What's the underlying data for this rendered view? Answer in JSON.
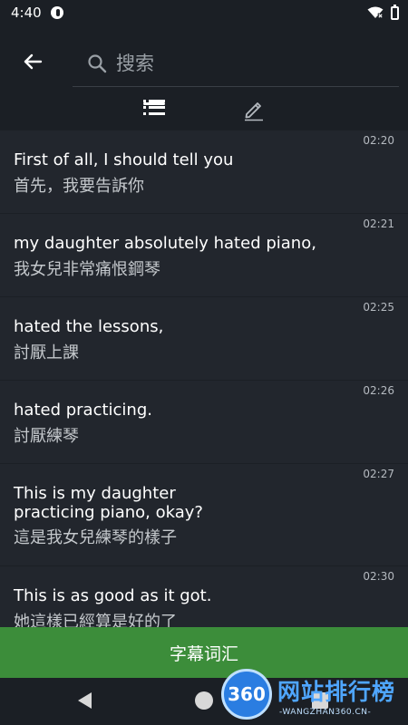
{
  "status_bar": {
    "time": "4:40"
  },
  "search": {
    "placeholder": "搜索"
  },
  "subtitles": [
    {
      "time": "02:20",
      "en": "First of all, I should tell you",
      "zh": "首先，我要告訴你"
    },
    {
      "time": "02:21",
      "en": "my daughter absolutely hated piano,",
      "zh": "我女兒非常痛恨鋼琴"
    },
    {
      "time": "02:25",
      "en": "hated the lessons,",
      "zh": "討厭上課"
    },
    {
      "time": "02:26",
      "en": "hated practicing.",
      "zh": "討厭練琴"
    },
    {
      "time": "02:27",
      "en": "This is my daughter\npracticing piano, okay?",
      "zh": "這是我女兒練琴的樣子"
    },
    {
      "time": "02:30",
      "en": "This is as good as it got.",
      "zh": "她這樣已經算是好的了"
    }
  ],
  "bottom_button": {
    "label": "字幕词汇"
  },
  "watermark": {
    "logo_text": "360",
    "title": "网站排行榜",
    "subtitle": "-WANGZHAN360.CN-"
  },
  "colors": {
    "accent_green": "#3c8d3a",
    "background": "#1b1f25",
    "list_background": "#22262d"
  }
}
